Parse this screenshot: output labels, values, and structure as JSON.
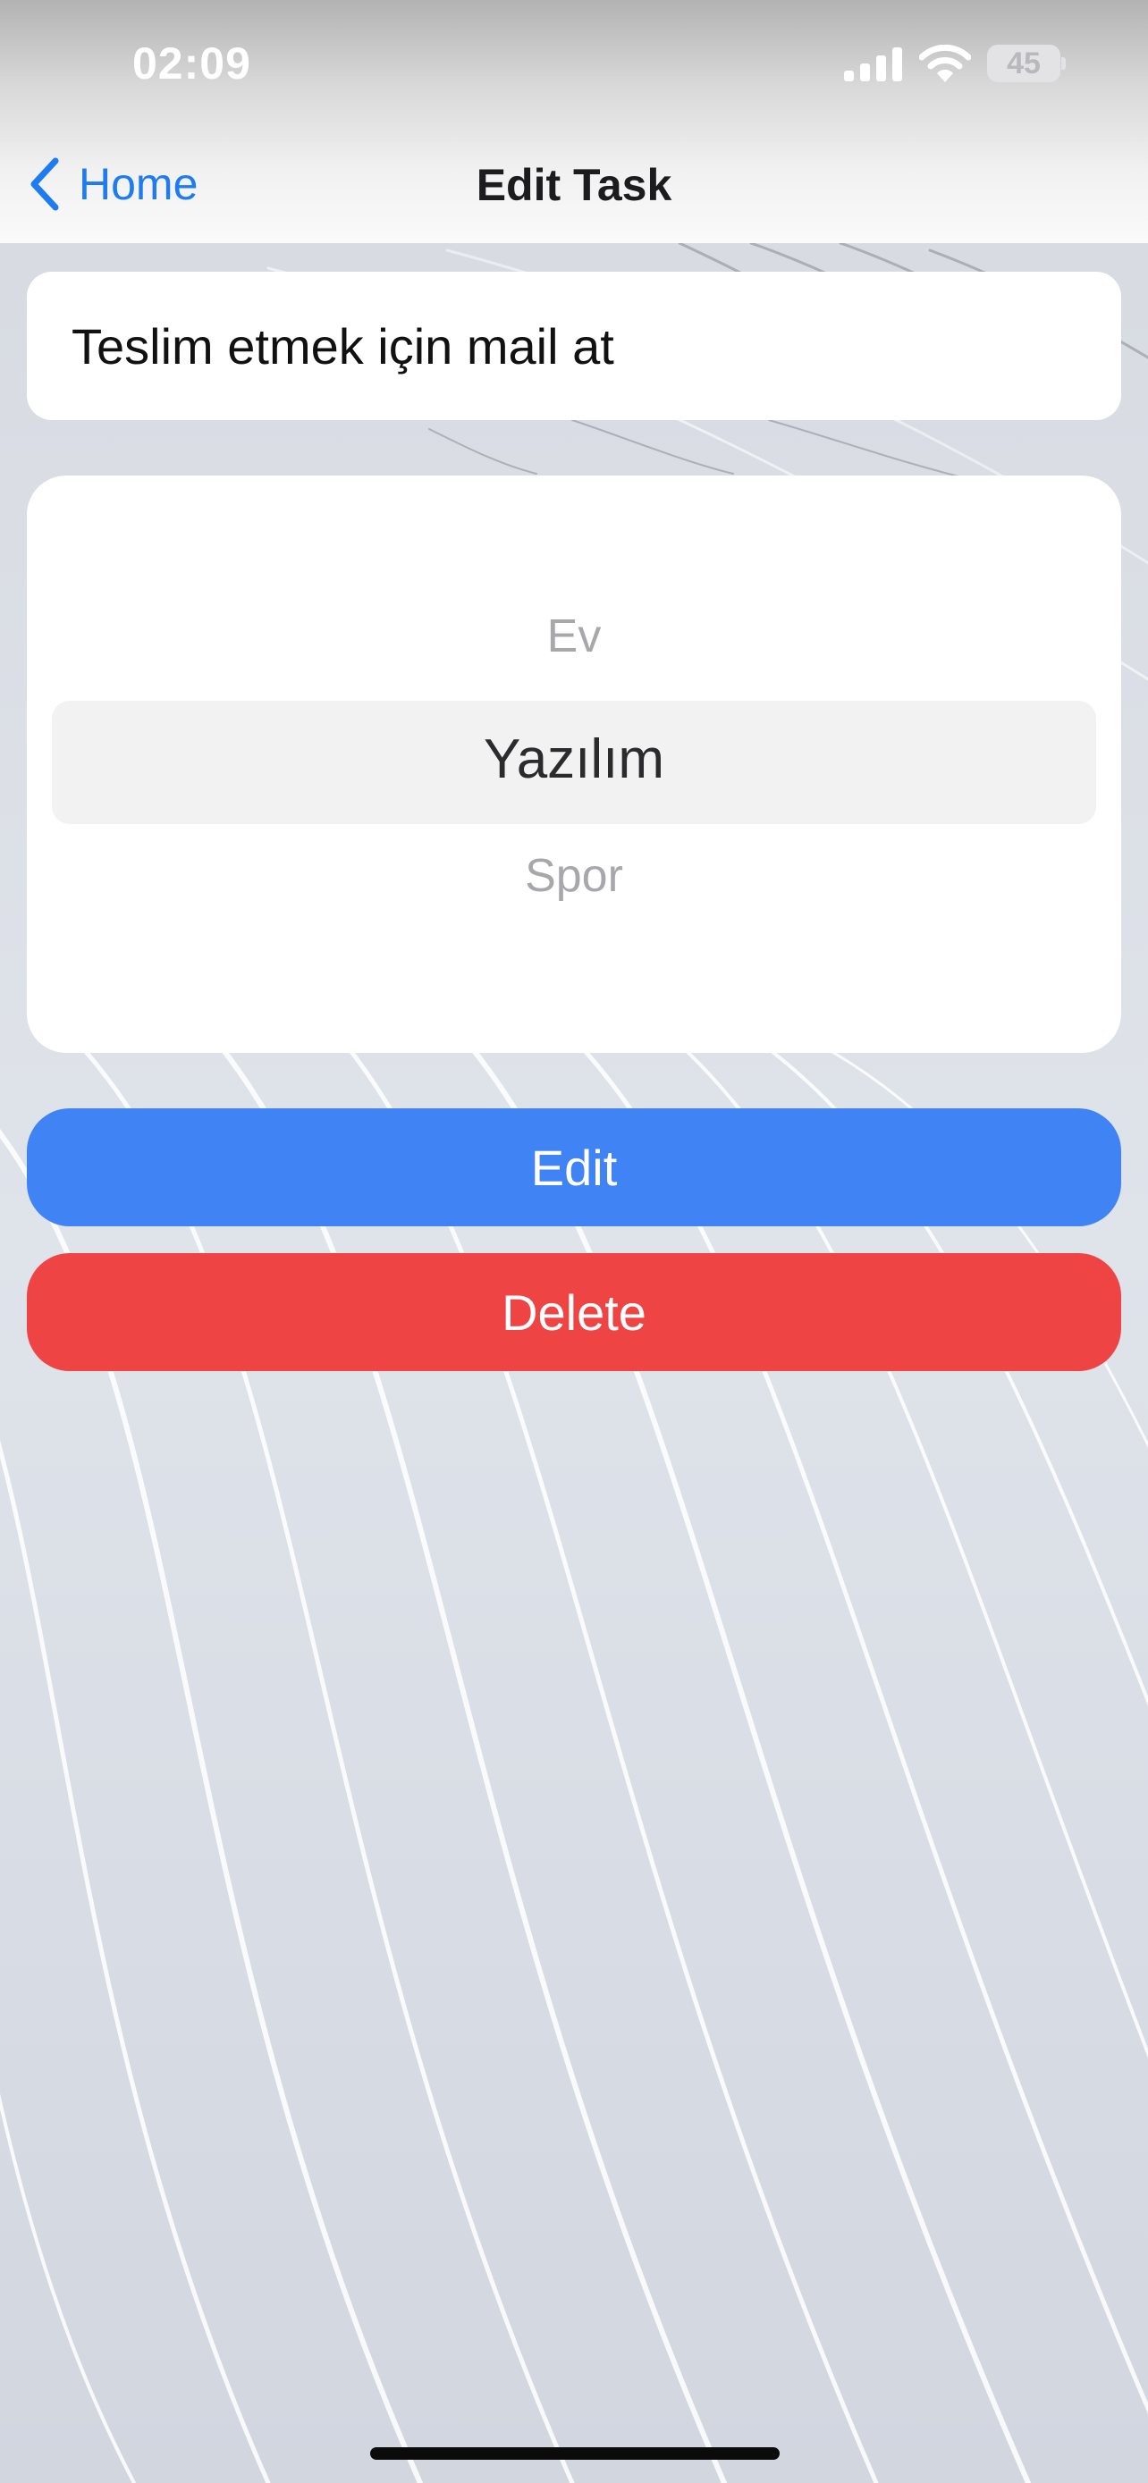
{
  "status_bar": {
    "time": "02:09",
    "battery_level": "45",
    "icons": [
      "cellular-signal-icon",
      "wifi-icon",
      "battery-icon"
    ]
  },
  "nav": {
    "back_label": "Home",
    "back_icon": "chevron-left-icon",
    "title": "Edit Task"
  },
  "task": {
    "value": "Teslim etmek için mail at"
  },
  "category_picker": {
    "above": "Ev",
    "selected": "Yazılım",
    "below": "Spor"
  },
  "actions": {
    "edit_label": "Edit",
    "delete_label": "Delete"
  },
  "colors": {
    "accent": "#1e7bf2",
    "edit_button": "#3f83f4",
    "delete_button": "#ef4444"
  }
}
